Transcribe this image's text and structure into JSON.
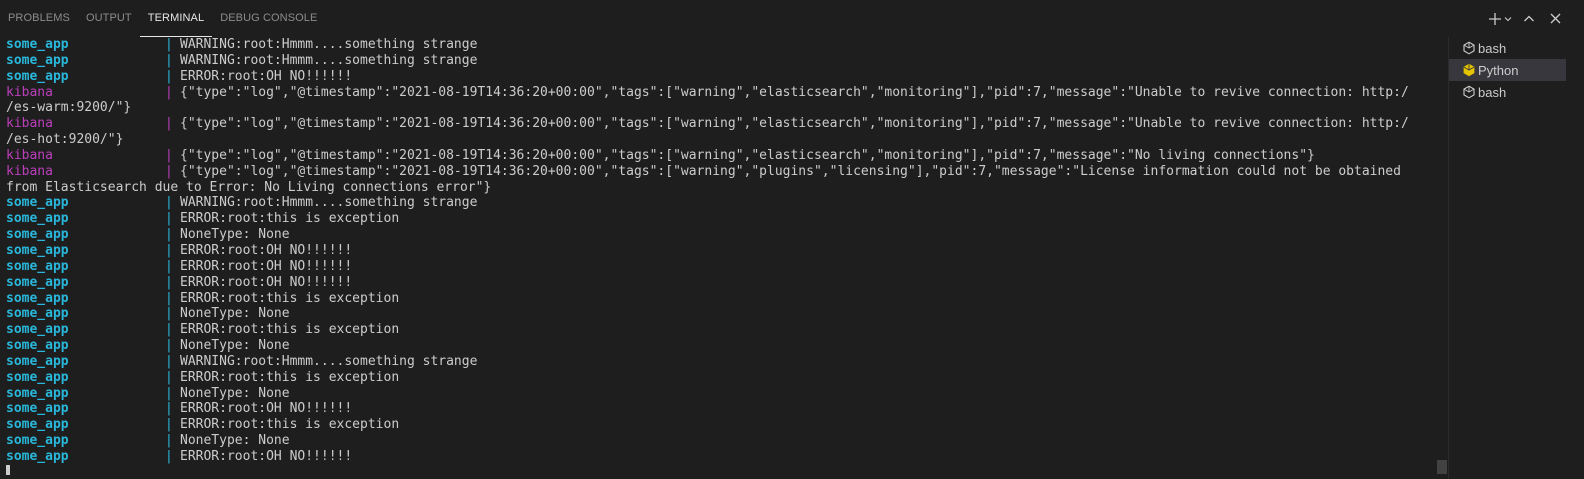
{
  "tabs": [
    {
      "label": "PROBLEMS",
      "active": false
    },
    {
      "label": "OUTPUT",
      "active": false
    },
    {
      "label": "TERMINAL",
      "active": true
    },
    {
      "label": "DEBUG CONSOLE",
      "active": false
    }
  ],
  "actions": {
    "new_terminal_icon": "plus-icon",
    "dropdown_icon": "chevron-down-icon",
    "maximize_icon": "chevron-up-icon",
    "close_icon": "close-icon"
  },
  "colors": {
    "background": "#1e1e1e",
    "some_app": "#29b8db",
    "kibana": "#bc3fbc",
    "text": "#cccccc",
    "python_icon": "#e5c400"
  },
  "terminal_lines": [
    {
      "service": "some_app",
      "message": "WARNING:root:Hmmm....something strange"
    },
    {
      "service": "some_app",
      "message": "WARNING:root:Hmmm....something strange"
    },
    {
      "service": "some_app",
      "message": "ERROR:root:OH NO!!!!!!"
    },
    {
      "service": "kibana",
      "message": "{\"type\":\"log\",\"@timestamp\":\"2021-08-19T14:36:20+00:00\",\"tags\":[\"warning\",\"elasticsearch\",\"monitoring\"],\"pid\":7,\"message\":\"Unable to revive connection: http:/"
    },
    {
      "service": "",
      "message": "/es-warm:9200/\"}"
    },
    {
      "service": "kibana",
      "message": "{\"type\":\"log\",\"@timestamp\":\"2021-08-19T14:36:20+00:00\",\"tags\":[\"warning\",\"elasticsearch\",\"monitoring\"],\"pid\":7,\"message\":\"Unable to revive connection: http:/"
    },
    {
      "service": "",
      "message": "/es-hot:9200/\"}"
    },
    {
      "service": "kibana",
      "message": "{\"type\":\"log\",\"@timestamp\":\"2021-08-19T14:36:20+00:00\",\"tags\":[\"warning\",\"elasticsearch\",\"monitoring\"],\"pid\":7,\"message\":\"No living connections\"}"
    },
    {
      "service": "kibana",
      "message": "{\"type\":\"log\",\"@timestamp\":\"2021-08-19T14:36:20+00:00\",\"tags\":[\"warning\",\"plugins\",\"licensing\"],\"pid\":7,\"message\":\"License information could not be obtained"
    },
    {
      "service": "",
      "message": "from Elasticsearch due to Error: No Living connections error\"}"
    },
    {
      "service": "some_app",
      "message": "WARNING:root:Hmmm....something strange"
    },
    {
      "service": "some_app",
      "message": "ERROR:root:this is exception"
    },
    {
      "service": "some_app",
      "message": "NoneType: None"
    },
    {
      "service": "some_app",
      "message": "ERROR:root:OH NO!!!!!!"
    },
    {
      "service": "some_app",
      "message": "ERROR:root:OH NO!!!!!!"
    },
    {
      "service": "some_app",
      "message": "ERROR:root:OH NO!!!!!!"
    },
    {
      "service": "some_app",
      "message": "ERROR:root:this is exception"
    },
    {
      "service": "some_app",
      "message": "NoneType: None"
    },
    {
      "service": "some_app",
      "message": "ERROR:root:this is exception"
    },
    {
      "service": "some_app",
      "message": "NoneType: None"
    },
    {
      "service": "some_app",
      "message": "WARNING:root:Hmmm....something strange"
    },
    {
      "service": "some_app",
      "message": "ERROR:root:this is exception"
    },
    {
      "service": "some_app",
      "message": "NoneType: None"
    },
    {
      "service": "some_app",
      "message": "ERROR:root:OH NO!!!!!!"
    },
    {
      "service": "some_app",
      "message": "ERROR:root:this is exception"
    },
    {
      "service": "some_app",
      "message": "NoneType: None"
    },
    {
      "service": "some_app",
      "message": "ERROR:root:OH NO!!!!!!"
    }
  ],
  "terminal_list": [
    {
      "label": "bash",
      "icon": "terminal-icon",
      "active": false
    },
    {
      "label": "Python",
      "icon": "python-icon",
      "active": true
    },
    {
      "label": "bash",
      "icon": "terminal-icon",
      "active": false
    }
  ]
}
